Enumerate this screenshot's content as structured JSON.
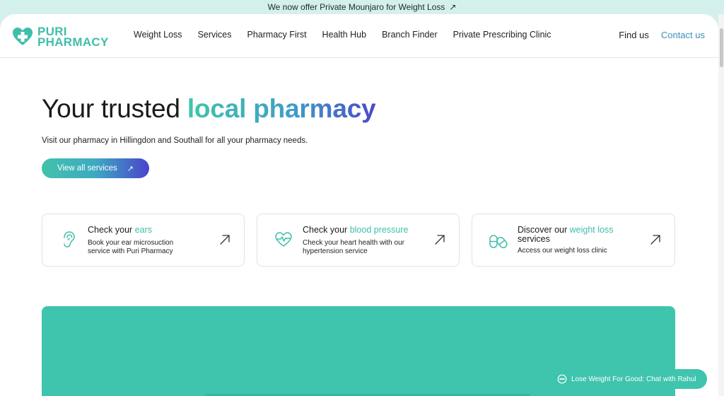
{
  "announcement": {
    "text": "We now offer Private Mounjaro for Weight Loss",
    "icon": "arrow-up-right-icon"
  },
  "brand": {
    "line1": "PURI",
    "line2": "PHARMACY",
    "color": "#3fbeaa"
  },
  "nav": {
    "items": [
      {
        "label": "Weight Loss"
      },
      {
        "label": "Services"
      },
      {
        "label": "Pharmacy First"
      },
      {
        "label": "Health Hub"
      },
      {
        "label": "Branch Finder"
      },
      {
        "label": "Private Prescribing Clinic"
      }
    ],
    "find_us": "Find us",
    "contact_us": "Contact us"
  },
  "hero": {
    "title_plain": "Your trusted ",
    "title_highlight": "local pharmacy",
    "subtitle": "Visit our pharmacy in Hillingdon and Southall for all your pharmacy needs.",
    "cta_label": "View all services"
  },
  "cards": [
    {
      "icon": "ear-icon",
      "title_prefix": "Check your ",
      "title_highlight": "ears",
      "title_suffix": "",
      "desc_line1": "Book your ear microsuction",
      "desc_line2": "service with Puri Pharmacy"
    },
    {
      "icon": "heart-pulse-icon",
      "title_prefix": "Check your ",
      "title_highlight": "blood pressure",
      "title_suffix": "",
      "desc_line1": "Check your heart health with our",
      "desc_line2": "hypertension service"
    },
    {
      "icon": "pills-icon",
      "title_prefix": "Discover our ",
      "title_highlight": "weight loss",
      "title_suffix": "services",
      "desc_line1": "Access our weight loss clinic",
      "desc_line2": ""
    }
  ],
  "chat": {
    "label": "Lose Weight For Good: Chat with Rahul",
    "icon": "chat-bubble-icon"
  },
  "colors": {
    "accent": "#3fc4ae",
    "gradient_end": "#4a44cc",
    "link": "#3e8fb8"
  }
}
